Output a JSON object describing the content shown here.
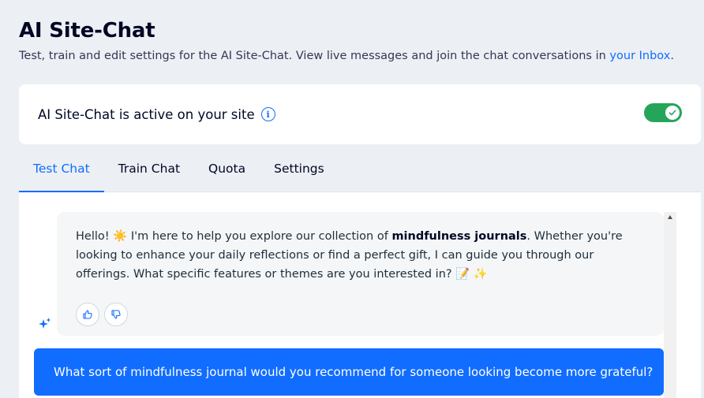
{
  "header": {
    "title": "AI Site-Chat",
    "subtitle_prefix": "Test, train and edit settings for the AI Site-Chat. View live messages and join the chat conversations in ",
    "inbox_link": "your Inbox",
    "subtitle_suffix": "."
  },
  "status_card": {
    "text": "AI Site-Chat is active on your site",
    "info_icon_glyph": "i",
    "toggle_on": true
  },
  "tabs": [
    {
      "label": "Test Chat",
      "active": true
    },
    {
      "label": "Train Chat",
      "active": false
    },
    {
      "label": "Quota",
      "active": false
    },
    {
      "label": "Settings",
      "active": false
    }
  ],
  "chat": {
    "bot_message": {
      "part1": "Hello! ",
      "emoji_sun": "☀️",
      "part2": " I'm here to help you explore our collection of ",
      "bold": "mindfulness journals",
      "part3": ". Whether you're looking to enhance your daily reflections or find a perfect gift, I can guide you through our offerings. What specific features or themes are you interested in? ",
      "emoji_end": "📝 ✨"
    },
    "user_message": "What sort of mindfulness journal would you recommend for someone looking become more grateful?"
  },
  "colors": {
    "accent": "#116dff",
    "toggle_on": "#25a55a",
    "sparkle": "#116dff"
  }
}
